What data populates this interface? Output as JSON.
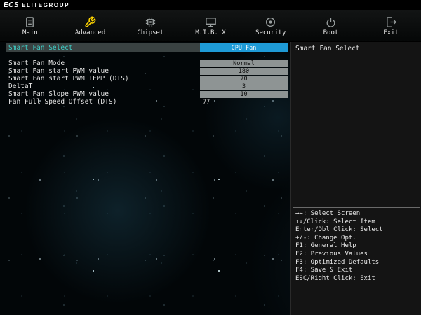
{
  "brand": {
    "mark": "ECS",
    "name": "ELITEGROUP"
  },
  "tabs": [
    {
      "label": "Main",
      "selected": false
    },
    {
      "label": "Advanced",
      "selected": true
    },
    {
      "label": "Chipset",
      "selected": false
    },
    {
      "label": "M.I.B. X",
      "selected": false
    },
    {
      "label": "Security",
      "selected": false
    },
    {
      "label": "Boot",
      "selected": false
    },
    {
      "label": "Exit",
      "selected": false
    }
  ],
  "settings": [
    {
      "label": "Smart Fan Select",
      "value": "CPU Fan",
      "selected": true,
      "editable": true
    },
    {
      "label": "Smart Fan Mode",
      "value": "Normal",
      "selected": false,
      "editable": true
    },
    {
      "label": "Smart Fan start PWM value",
      "value": "180",
      "selected": false,
      "editable": true
    },
    {
      "label": "Smart Fan start PWM TEMP (DTS)",
      "value": "70",
      "selected": false,
      "editable": true
    },
    {
      "label": "DeltaT",
      "value": "3",
      "selected": false,
      "editable": true
    },
    {
      "label": "Smart Fan Slope PWM value",
      "value": "10",
      "selected": false,
      "editable": true
    },
    {
      "label": "Fan Full Speed Offset (DTS)",
      "value": "77",
      "selected": false,
      "editable": false
    }
  ],
  "help_panel": {
    "title": "Smart Fan Select",
    "keys": [
      "→←: Select Screen",
      "↑↓/Click: Select Item",
      "Enter/Dbl Click: Select",
      "+/-: Change Opt.",
      "F1: General Help",
      "F2: Previous Values",
      "F3: Optimized Defaults",
      "F4: Save & Exit",
      "ESC/Right Click: Exit"
    ]
  },
  "colors": {
    "accent_blue": "#1e9ad6",
    "accent_yellow": "#ffd400",
    "selected_label_teal": "#3fd0c8",
    "value_box_gray": "#8e9494",
    "panel_bg": "#141414"
  }
}
